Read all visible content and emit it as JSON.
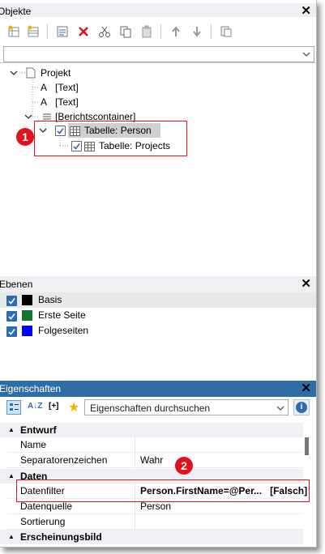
{
  "objects_panel": {
    "title": "Objekte",
    "close": "✕",
    "toolbar_icons": [
      "new-table-icon",
      "new-table-2-icon",
      "properties-icon",
      "delete-icon",
      "cut-icon",
      "copy-icon",
      "paste-icon",
      "move-up-icon",
      "move-down-icon",
      "copy-to-icon"
    ],
    "tree": {
      "root": "Projekt",
      "text1": "[Text]",
      "text2": "[Text]",
      "container": "[Berichtscontainer]",
      "table_person": "Tabelle: Person",
      "table_projects": "Tabelle: Projects",
      "marker": "1"
    }
  },
  "layers_panel": {
    "title": "Ebenen",
    "close": "✕",
    "items": [
      {
        "label": "Basis",
        "color": "#000000"
      },
      {
        "label": "Erste Seite",
        "color": "#0f7a2f"
      },
      {
        "label": "Folgeseiten",
        "color": "#0000ff"
      }
    ]
  },
  "properties_panel": {
    "title": "Eigenschaften",
    "close": "✕",
    "toolbar": {
      "az_label": "A↓Z",
      "expr_label": "[+]",
      "search_placeholder": "Eigenschaften durchsuchen",
      "info": "i"
    },
    "categories": {
      "design": "Entwurf",
      "data": "Daten",
      "appearance": "Erscheinungsbild"
    },
    "rows": {
      "name": {
        "key": "Name",
        "value": ""
      },
      "separator": {
        "key": "Separatorenzeichen",
        "value": "Wahr"
      },
      "datafilter": {
        "key": "Datenfilter",
        "value": "Person.FirstName=@Per...   [Falsch]"
      },
      "datasource": {
        "key": "Datenquelle",
        "value": "Person"
      },
      "sort": {
        "key": "Sortierung",
        "value": ""
      }
    },
    "marker": "2"
  }
}
